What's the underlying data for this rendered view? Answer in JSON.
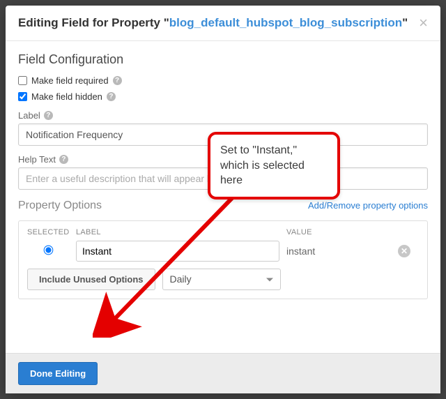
{
  "header": {
    "prefix": "Editing Field for Property \"",
    "property_name": "blog_default_hubspot_blog_subscription",
    "suffix": "\""
  },
  "config": {
    "section_title": "Field Configuration",
    "required_label": "Make field required",
    "required_checked": false,
    "hidden_label": "Make field hidden",
    "hidden_checked": true,
    "label_field_label": "Label",
    "label_value": "Notification Frequency",
    "help_field_label": "Help Text",
    "help_placeholder": "Enter a useful description that will appear below the label."
  },
  "options": {
    "section_title": "Property Options",
    "add_remove_link": "Add/Remove property options",
    "col_selected": "SELECTED",
    "col_label": "LABEL",
    "col_value": "VALUE",
    "row_label": "Instant",
    "row_value": "instant",
    "include_unused_btn": "Include Unused Options",
    "unused_select": "Daily"
  },
  "footer": {
    "done_btn": "Done Editing"
  },
  "annotation": {
    "text": "Set to \"Instant,\" which is selected here"
  }
}
